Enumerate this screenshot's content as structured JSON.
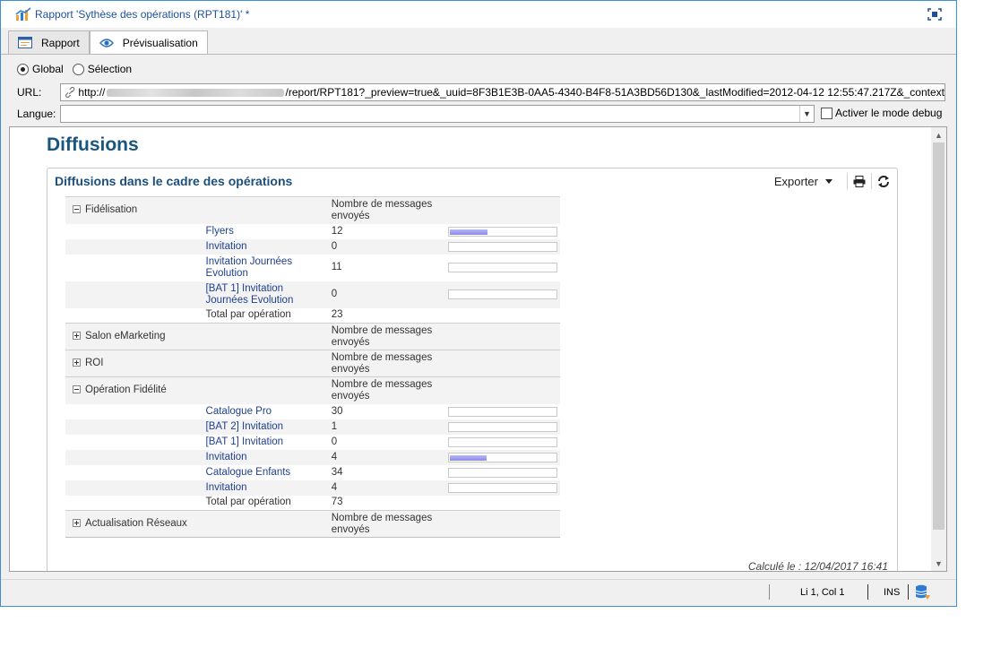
{
  "window": {
    "title": "Rapport 'Sythèse des opérations (RPT181)' *"
  },
  "tabs": [
    {
      "label": "Rapport",
      "icon": "report-icon"
    },
    {
      "label": "Prévisualisation",
      "icon": "eye-icon"
    }
  ],
  "scope": {
    "global_label": "Global",
    "selection_label": "Sélection",
    "selected": "Global"
  },
  "url": {
    "label": "URL:",
    "prefix": "http://",
    "suffix": "/report/RPT181?_preview=true&_uuid=8F3B1E3B-0AA5-4340-B4F8-51A3BD56D130&_lastModified=2012-04-12 12:55:47.217Z&_context"
  },
  "langue": {
    "label": "Langue:",
    "value": "",
    "debug_label": "Activer le mode debug",
    "debug_checked": false
  },
  "report": {
    "heading": "Diffusions",
    "panel_title": "Diffusions dans le cadre des opérations",
    "export_label": "Exporter",
    "metric_header": "Nombre de messages envoyés",
    "computed_label": "Calculé le : 12/04/2017 16:41",
    "groups": [
      {
        "name": "Fidélisation",
        "expanded": true,
        "rows": [
          {
            "name": "Flyers",
            "value": "12",
            "bar_fraction": 0.35
          },
          {
            "name": "Invitation",
            "value": "0",
            "bar_fraction": 0
          },
          {
            "name": "Invitation Journées Evolution",
            "value": "11",
            "bar_fraction": 0
          },
          {
            "name": "[BAT 1] Invitation Journées Evolution",
            "value": "0",
            "bar_fraction": 0
          }
        ],
        "total_label": "Total par opération",
        "total": "23"
      },
      {
        "name": "Salon eMarketing",
        "expanded": false,
        "rows": [],
        "total_label": "",
        "total": ""
      },
      {
        "name": "ROI",
        "expanded": false,
        "rows": [],
        "total_label": "",
        "total": ""
      },
      {
        "name": "Opération Fidélité",
        "expanded": true,
        "rows": [
          {
            "name": "Catalogue Pro",
            "value": "30",
            "bar_fraction": 0
          },
          {
            "name": "[BAT 2] Invitation",
            "value": "1",
            "bar_fraction": 0
          },
          {
            "name": "[BAT 1] Invitation",
            "value": "0",
            "bar_fraction": 0
          },
          {
            "name": "Invitation",
            "value": "4",
            "bar_fraction": 0.34
          },
          {
            "name": "Catalogue Enfants",
            "value": "34",
            "bar_fraction": 0
          },
          {
            "name": "Invitation",
            "value": "4",
            "bar_fraction": 0
          }
        ],
        "total_label": "Total par opération",
        "total": "73"
      },
      {
        "name": "Actualisation Réseaux",
        "expanded": false,
        "rows": [],
        "total_label": "",
        "total": ""
      }
    ]
  },
  "status": {
    "position": "Li 1, Col 1",
    "mode": "INS"
  },
  "colors": {
    "accent": "#18557f",
    "link": "#1f3f8f",
    "bar": "#9a9aee"
  }
}
